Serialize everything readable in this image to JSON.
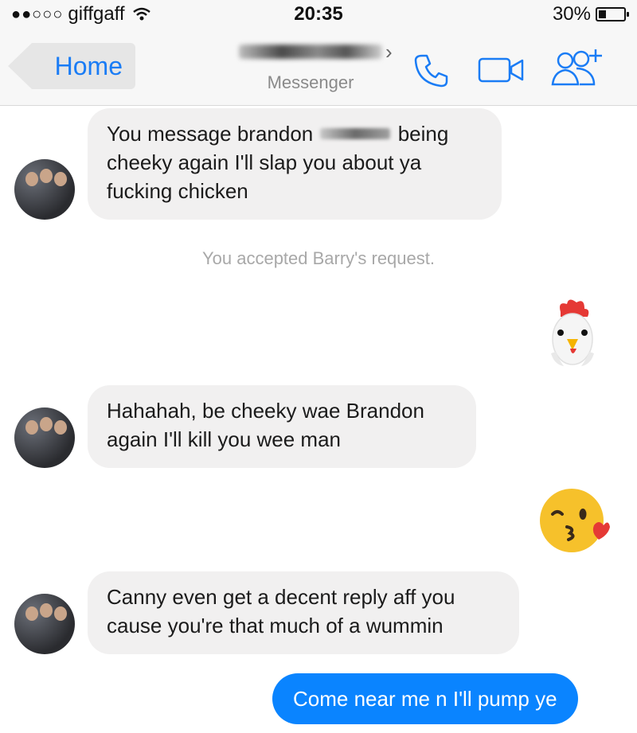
{
  "status_bar": {
    "carrier": "giffgaff",
    "signal_dots": "●●○○○",
    "time": "20:35",
    "battery_percent_text": "30%",
    "battery_level": 0.3
  },
  "nav": {
    "back_label": "Home",
    "contact_chevron": "›",
    "subtitle": "Messenger",
    "icons": [
      "phone-icon",
      "video-icon",
      "add-people-icon"
    ],
    "accent_color": "#1a7cf5"
  },
  "messages": {
    "m1": {
      "line1_a": "You message brandon",
      "line1_b": "being",
      "line2": "cheeky again I'll slap you about ya",
      "line3": "fucking chicken"
    },
    "system": "You accepted Barry's request.",
    "m2_emoji": "chicken-emoji",
    "m3": {
      "line1": "Hahahah, be cheeky wae Brandon",
      "line2": "again I'll kill you wee man"
    },
    "m4_emoji": "kissing-wink-emoji",
    "m5": {
      "line1": "Canny even get a decent reply aff you",
      "line2": "cause you're that much of a wummin"
    },
    "m6": "Come near me n I'll pump ye"
  },
  "colors": {
    "outgoing_bubble": "#0a84ff",
    "incoming_bubble": "#f1f0f0"
  }
}
